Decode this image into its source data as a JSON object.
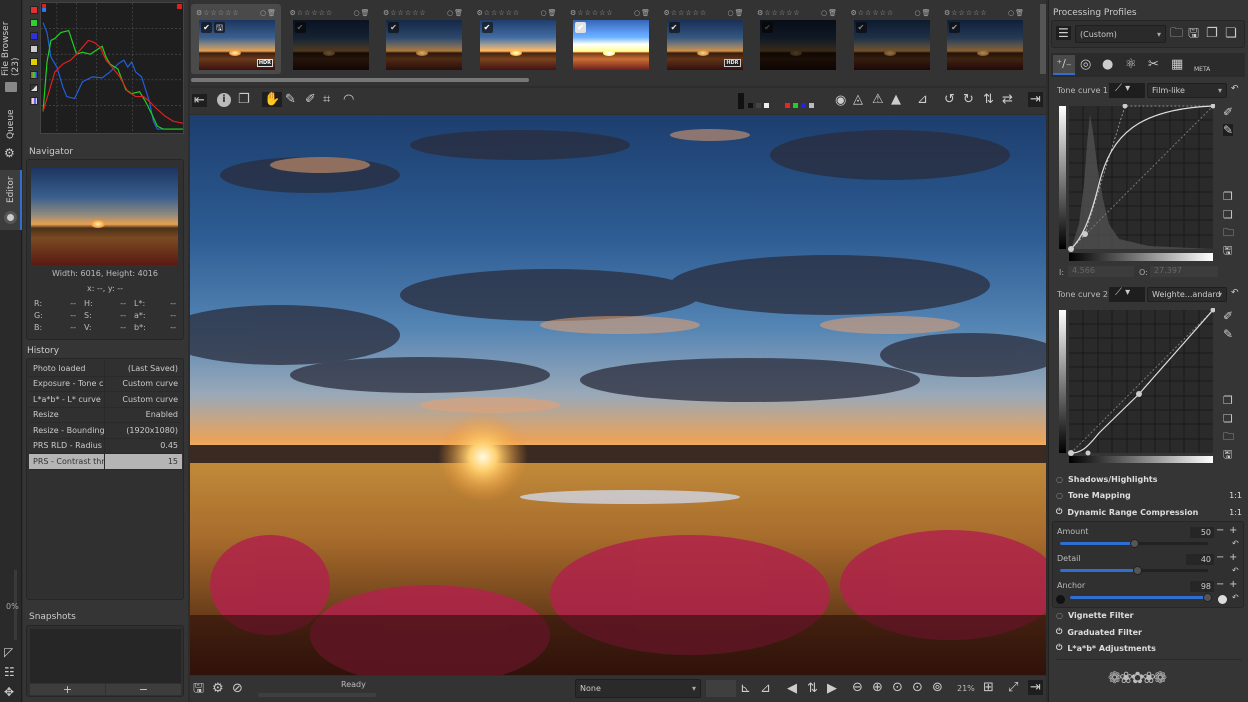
{
  "vtabs": {
    "file_browser": "File Browser (23)",
    "queue": "Queue",
    "editor": "Editor",
    "zoom_percent": "0%"
  },
  "navigator": {
    "title": "Navigator",
    "dimensions": "Width: 6016, Height: 4016",
    "coords": "x: --, y: --",
    "readouts": [
      {
        "label": "R:",
        "value": "--"
      },
      {
        "label": "H:",
        "value": "--"
      },
      {
        "label": "L*:",
        "value": "--"
      },
      {
        "label": "G:",
        "value": "--"
      },
      {
        "label": "S:",
        "value": "--"
      },
      {
        "label": "a*:",
        "value": "--"
      },
      {
        "label": "B:",
        "value": "--"
      },
      {
        "label": "V:",
        "value": "--"
      },
      {
        "label": "b*:",
        "value": "--"
      }
    ]
  },
  "history": {
    "title": "History",
    "rows": [
      {
        "action": "Photo loaded",
        "value": "(Last Saved)"
      },
      {
        "action": "Exposure - Tone c...",
        "value": "Custom curve"
      },
      {
        "action": "L*a*b* - L* curve",
        "value": "Custom curve"
      },
      {
        "action": "Resize",
        "value": "Enabled"
      },
      {
        "action": "Resize - Bounding...",
        "value": "(1920x1080)"
      },
      {
        "action": "PRS RLD - Radius",
        "value": "0.45"
      },
      {
        "action": "PRS - Contrast thr...",
        "value": "15",
        "selected": true
      }
    ]
  },
  "snapshots": {
    "title": "Snapshots",
    "add": "+",
    "remove": "−"
  },
  "filmstrip": {
    "hdr_badge": "HDR",
    "thumbnails": [
      {
        "checked": true,
        "saved": true,
        "hdr": true,
        "selected": true
      },
      {
        "checked": true
      },
      {
        "checked": true
      },
      {
        "checked": true
      },
      {
        "checked": true,
        "gray_check": true
      },
      {
        "checked": true,
        "hdr": true
      },
      {
        "checked": true
      },
      {
        "checked": true
      },
      {
        "checked": true
      }
    ]
  },
  "statusbar": {
    "status": "Ready",
    "preview_mode": "None",
    "zoom": "21%"
  },
  "right": {
    "profiles_title": "Processing Profiles",
    "profile": "(Custom)",
    "meta_tab": "META",
    "tone_curve_1": {
      "label": "Tone curve 1:",
      "mode": "Film-like",
      "in_label": "I:",
      "in_value": "4.566",
      "out_label": "O:",
      "out_value": "27.397"
    },
    "tone_curve_2": {
      "label": "Tone curve 2:",
      "mode": "Weighte...andard"
    },
    "tools": {
      "shadows_highlights": "Shadows/Highlights",
      "tone_mapping": "Tone Mapping",
      "tone_mapping_badge": "1:1",
      "drc": "Dynamic Range Compression",
      "drc_badge": "1:1",
      "vignette": "Vignette Filter",
      "graduated": "Graduated Filter",
      "lab": "L*a*b* Adjustments"
    },
    "sliders": [
      {
        "label": "Amount",
        "value": "50",
        "fraction": 0.5
      },
      {
        "label": "Detail",
        "value": "40",
        "fraction": 0.52
      },
      {
        "label": "Anchor",
        "value": "98",
        "fraction": 0.98
      }
    ]
  },
  "colors": {
    "accent": "#2f6fd1",
    "hist_red": "#e02020",
    "hist_green": "#20d020",
    "hist_blue": "#2060e0"
  }
}
